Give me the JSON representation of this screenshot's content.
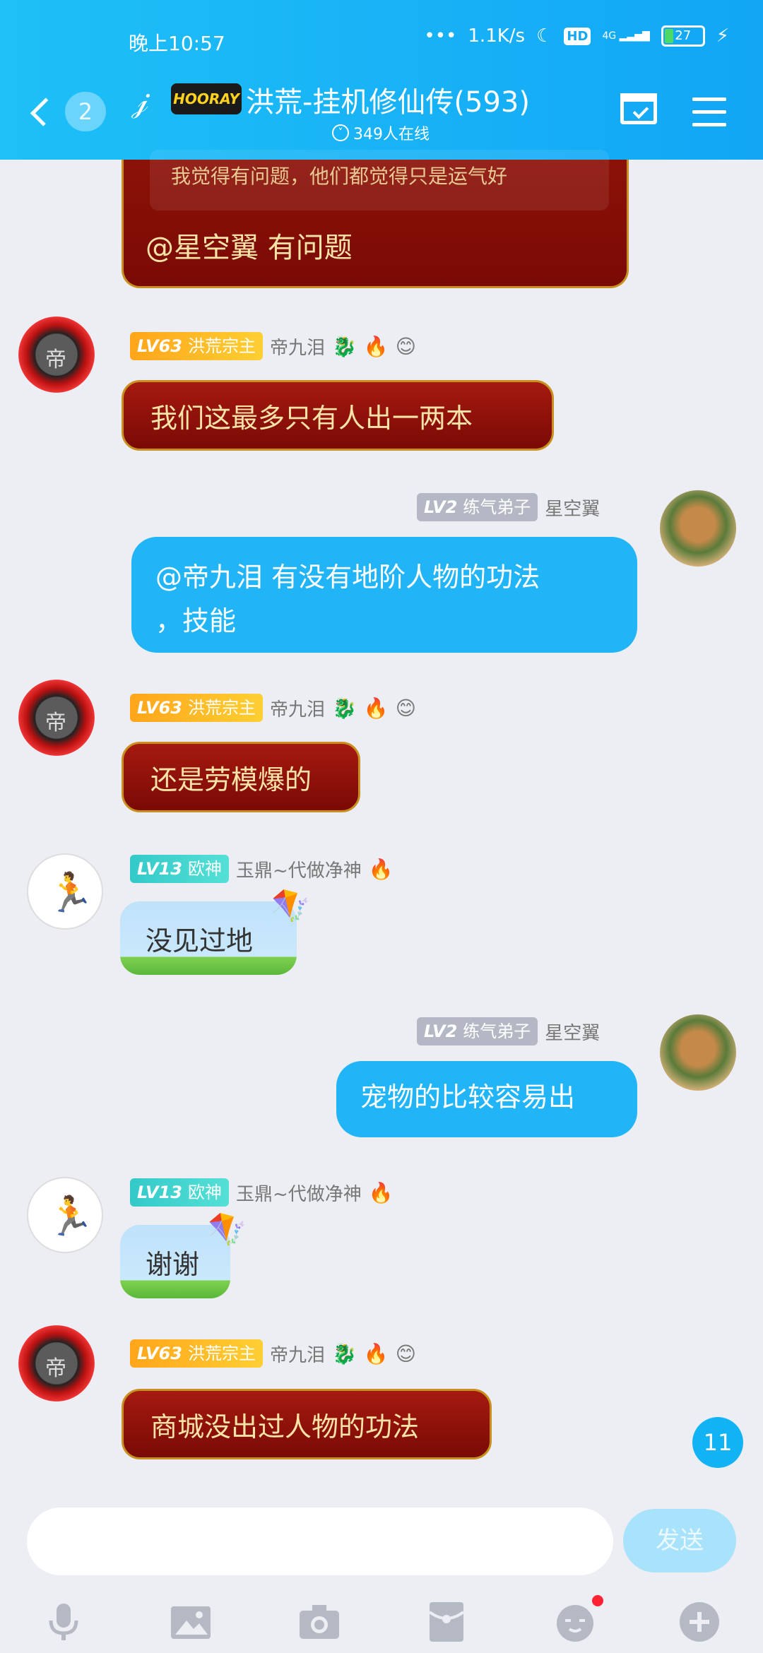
{
  "status_bar": {
    "time": "晚上10:57",
    "network_speed": "1.1K/s",
    "hd": "HD",
    "signal": "4G",
    "battery": "27"
  },
  "header": {
    "back_count": "2",
    "badge": "HOORAY",
    "title": "洪荒-挂机修仙传(593)",
    "online": "349人在线"
  },
  "messages": [
    {
      "id": "m0",
      "quote": "我觉得有问题，他们都觉得只是运气好",
      "text": "@星空翼  有问题"
    },
    {
      "id": "m1",
      "level": "LV63",
      "title": "洪荒宗主",
      "name": "帝九泪",
      "badges": [
        "🐉",
        "🔥",
        "😊"
      ],
      "text": "我们这最多只有人出一两本"
    },
    {
      "id": "m2",
      "level": "LV2",
      "title": "练气弟子",
      "name": "星空翼",
      "text_line1": "@帝九泪  有没有地阶人物的功法",
      "text_line2": "，技能"
    },
    {
      "id": "m3",
      "level": "LV63",
      "title": "洪荒宗主",
      "name": "帝九泪",
      "badges": [
        "🐉",
        "🔥",
        "😊"
      ],
      "text": "还是劳模爆的"
    },
    {
      "id": "m4",
      "level": "LV13",
      "title": "欧神",
      "name": "玉鼎~代做净神",
      "badges": [
        "🔥"
      ],
      "text": "没见过地"
    },
    {
      "id": "m5",
      "level": "LV2",
      "title": "练气弟子",
      "name": "星空翼",
      "text": "宠物的比较容易出"
    },
    {
      "id": "m6",
      "level": "LV13",
      "title": "欧神",
      "name": "玉鼎~代做净神",
      "badges": [
        "🔥"
      ],
      "text": "谢谢"
    },
    {
      "id": "m7",
      "level": "LV63",
      "title": "洪荒宗主",
      "name": "帝九泪",
      "badges": [
        "🐉",
        "🔥",
        "😊"
      ],
      "text": "商城没出过人物的功法"
    }
  ],
  "unread_count": "11",
  "input": {
    "placeholder": "",
    "send_label": "发送"
  },
  "toolbar_icons": [
    "mic-icon",
    "image-icon",
    "camera-icon",
    "red-packet-icon",
    "emoji-icon",
    "plus-icon"
  ],
  "colors": {
    "header": "#12a6f5",
    "self_bubble": "#21b5f7",
    "red_bubble": "#8c1208",
    "background": "#eceef3"
  }
}
